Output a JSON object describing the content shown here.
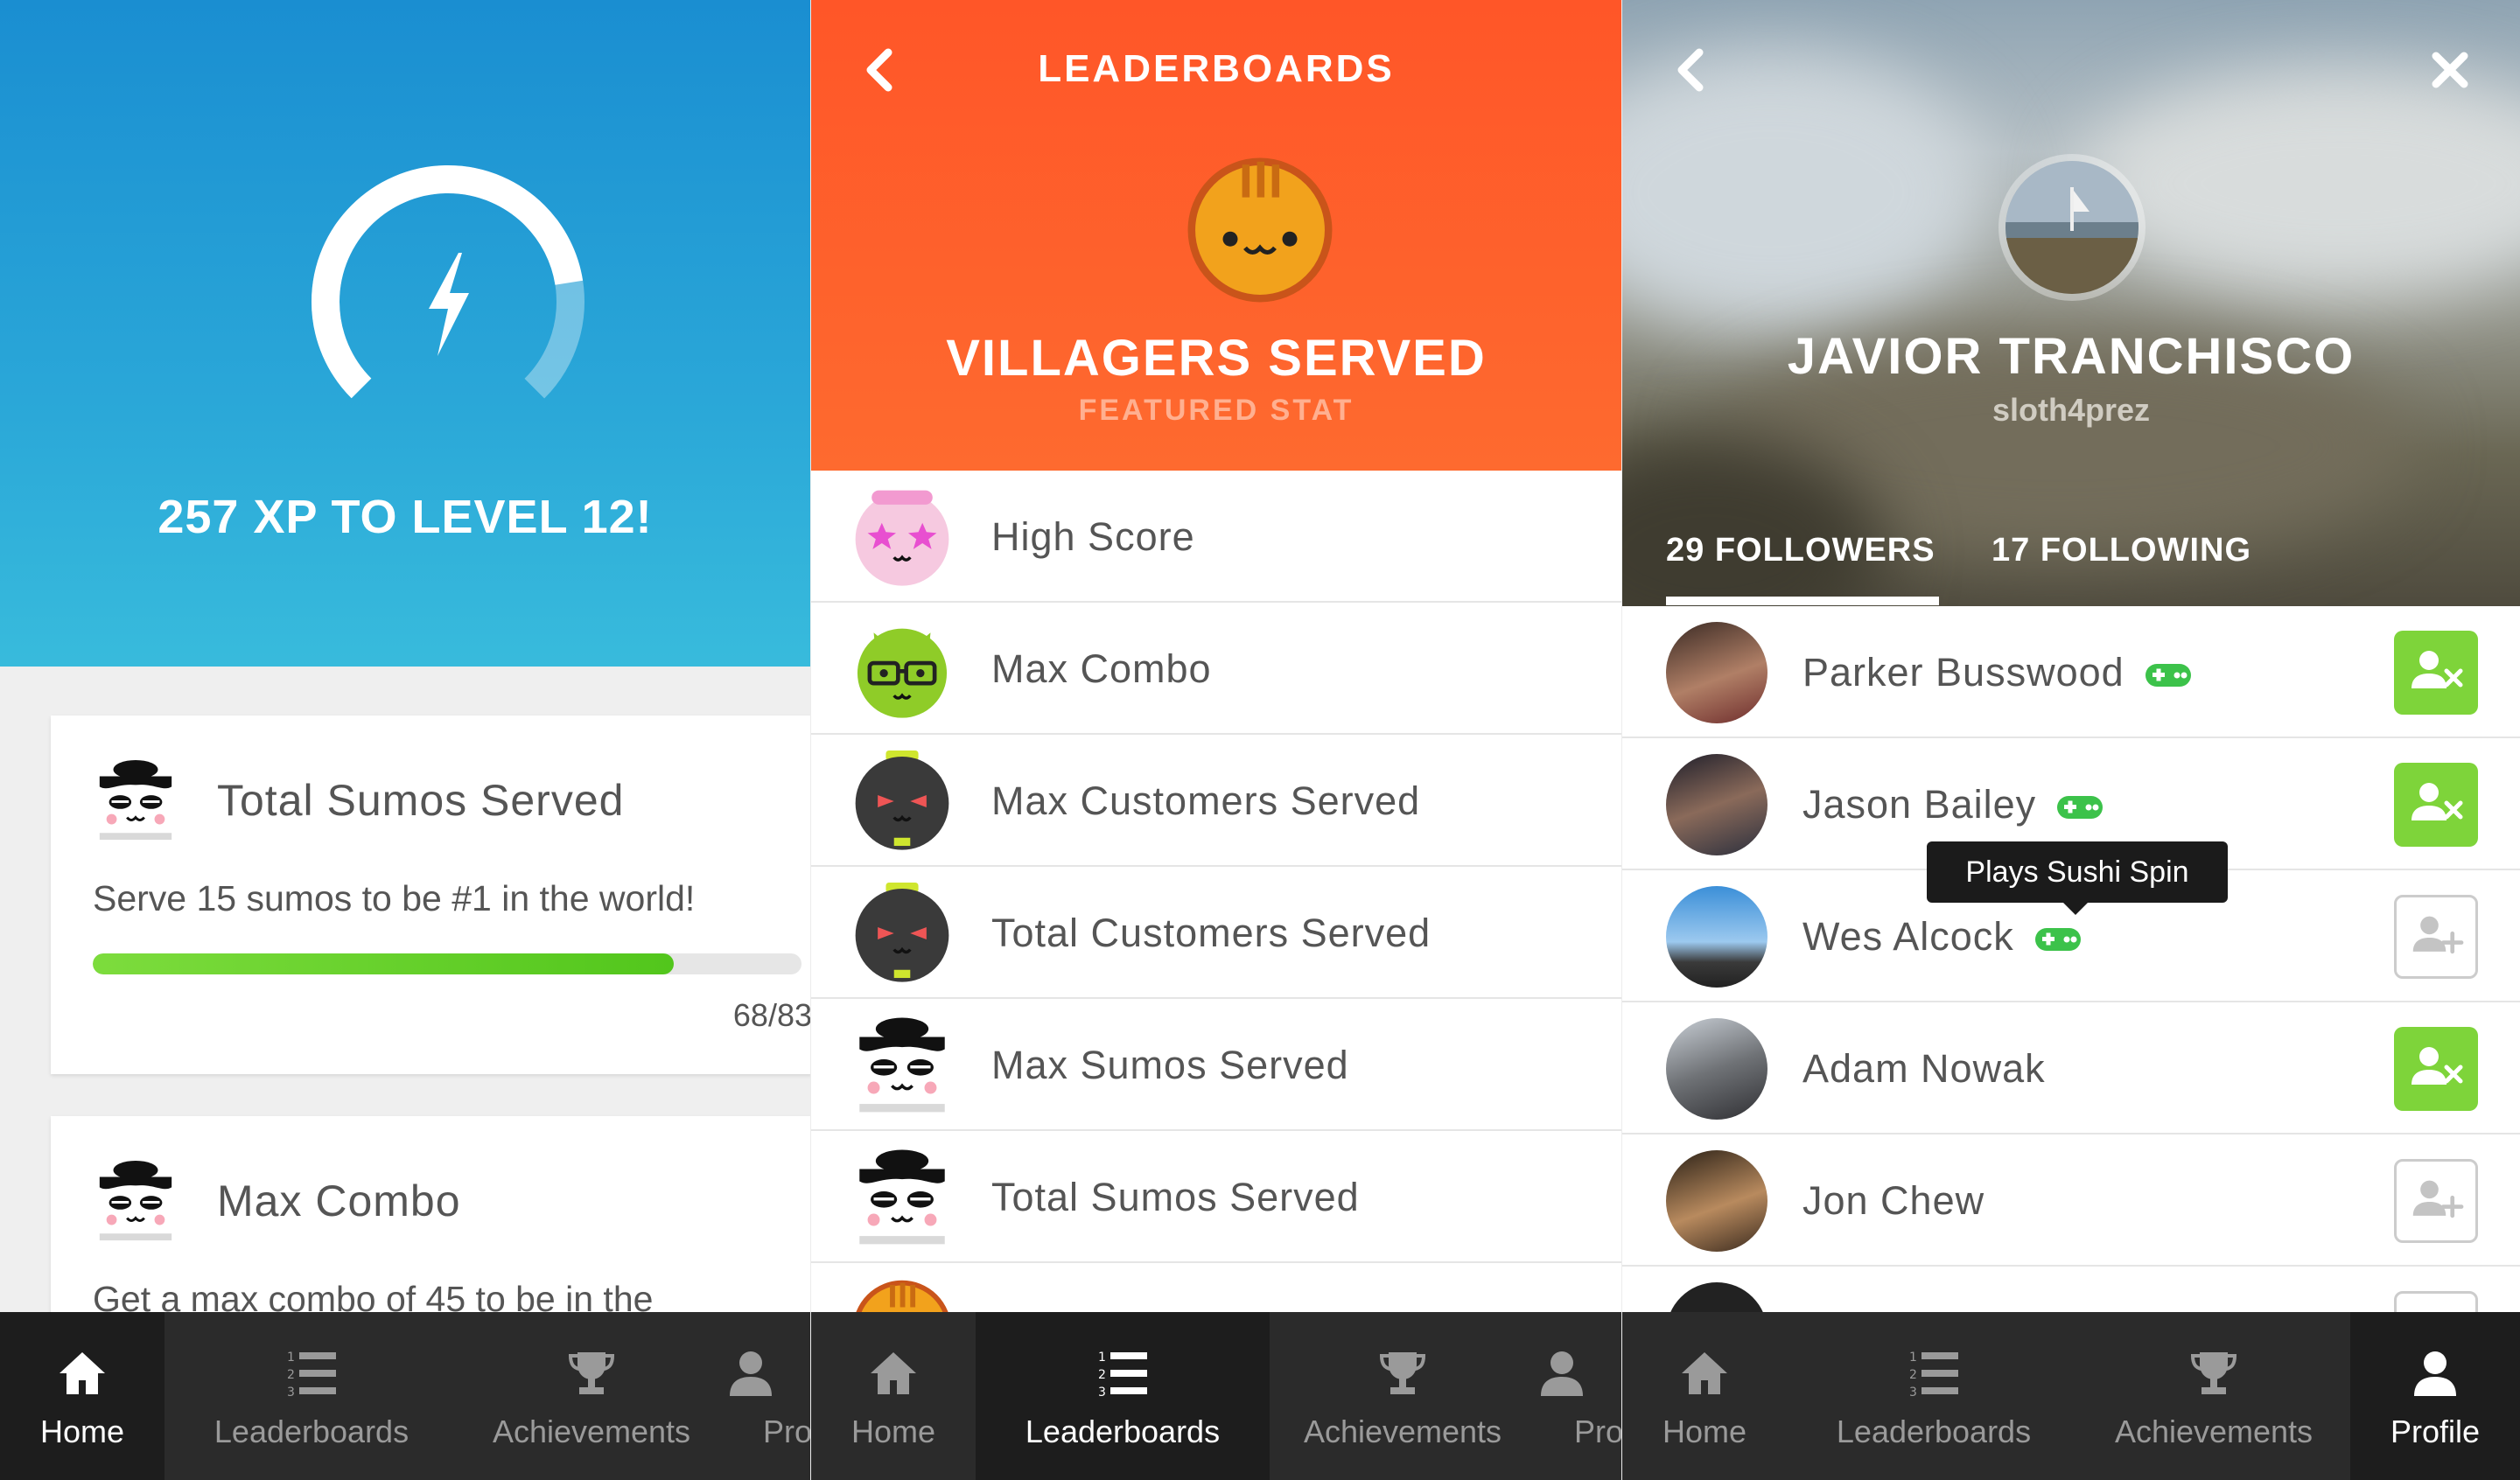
{
  "panel_home": {
    "xp_text": "257 XP TO LEVEL 12!",
    "xp_progress": 0.8,
    "cards": [
      {
        "title": "Total Sumos Served",
        "description": "Serve 15 sumos to be #1 in the world!",
        "count": "68/83",
        "progress": 0.82,
        "icon": "sumo-icon"
      },
      {
        "title": "Max Combo",
        "description": "Get a max combo of 45 to be in the",
        "icon": "sumo-icon"
      }
    ]
  },
  "panel_leaderboards": {
    "header_title": "LEADERBOARDS",
    "stat_title": "VILLAGERS SERVED",
    "stat_subtitle": "FEATURED STAT",
    "items": [
      {
        "label": "High Score",
        "icon": "pink-star-cat-icon"
      },
      {
        "label": "Max Combo",
        "icon": "green-glasses-cat-icon"
      },
      {
        "label": "Max Customers Served",
        "icon": "black-cat-icon"
      },
      {
        "label": "Total Customers Served",
        "icon": "black-cat-icon"
      },
      {
        "label": "Max Sumos Served",
        "icon": "sumo-icon"
      },
      {
        "label": "Total Sumos Served",
        "icon": "sumo-icon"
      }
    ]
  },
  "panel_profile": {
    "name": "JAVIOR TRANCHISCO",
    "username": "sloth4prez",
    "tabs": {
      "followers": "29 FOLLOWERS",
      "following": "17 FOLLOWING"
    },
    "tooltip": "Plays Sushi Spin",
    "friends": [
      {
        "name": "Parker Busswood",
        "plays_game": true,
        "is_following": true
      },
      {
        "name": "Jason Bailey",
        "plays_game": true,
        "is_following": true
      },
      {
        "name": "Wes Alcock",
        "plays_game": true,
        "is_following": false
      },
      {
        "name": "Adam Nowak",
        "plays_game": false,
        "is_following": true
      },
      {
        "name": "Jon Chew",
        "plays_game": false,
        "is_following": false
      }
    ]
  },
  "tabbar": {
    "home": "Home",
    "leaderboards": "Leaderboards",
    "achievements": "Achievements",
    "profile": "Profile",
    "profile_truncated": "Pro"
  },
  "colors": {
    "home_blue": "#1a8ed1",
    "leaderboard_orange": "#ff5628",
    "follow_green": "#7ed43a",
    "tabbar_dark": "#2b2b2b"
  }
}
